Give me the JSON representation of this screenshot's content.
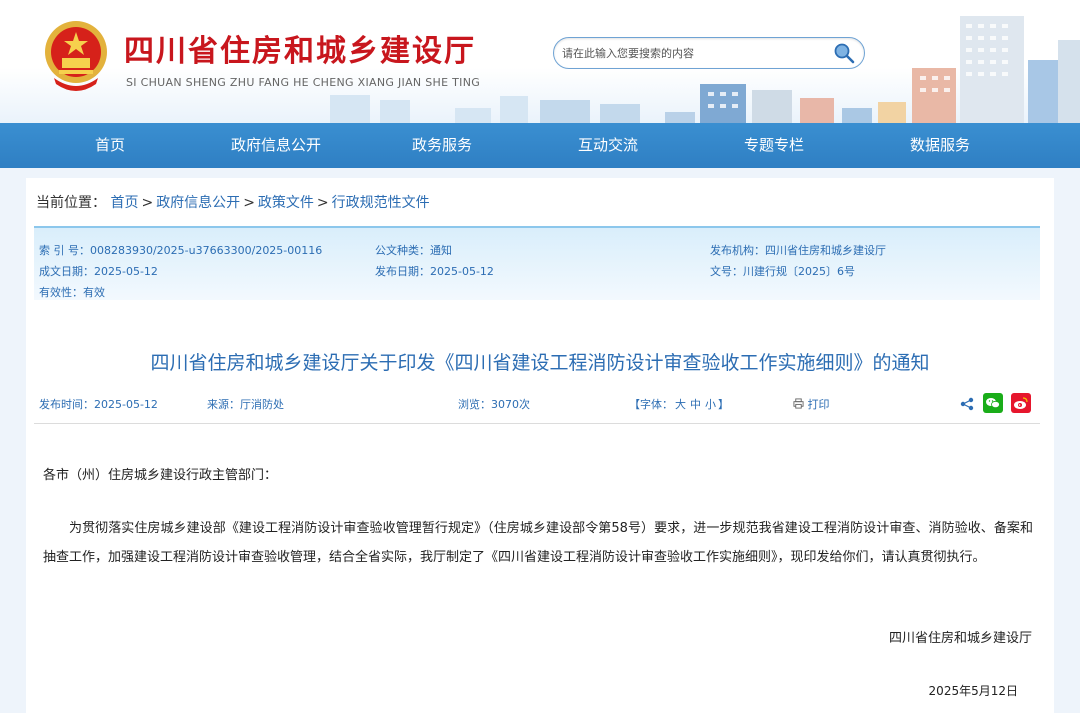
{
  "header": {
    "site_title": "四川省住房和城乡建设厅",
    "site_pinyin": "SI CHUAN SHENG ZHU FANG HE CHENG XIANG JIAN SHE TING",
    "search_placeholder": "请在此输入您要搜索的内容"
  },
  "nav": {
    "items": [
      {
        "label": "首页"
      },
      {
        "label": "政府信息公开"
      },
      {
        "label": "政务服务"
      },
      {
        "label": "互动交流"
      },
      {
        "label": "专题专栏"
      },
      {
        "label": "数据服务"
      }
    ]
  },
  "breadcrumb": {
    "prefix": "当前位置：",
    "items": [
      "首页",
      "政府信息公开",
      "政策文件",
      "行政规范性文件"
    ],
    "separator": ">"
  },
  "meta": {
    "index_no": "索 引 号：008283930/2025-u37663300/2025-00116",
    "category": "公文种类：通知",
    "publisher": "发布机构：四川省住房和城乡建设厅",
    "created": "成文日期：2025-05-12",
    "published": "发布日期：2025-05-12",
    "doc_no": "文号：川建行规〔2025〕6号",
    "validity": "有效性：有效"
  },
  "article": {
    "title": "四川省住房和城乡建设厅关于印发《四川省建设工程消防设计审查验收工作实施细则》的通知",
    "pub_time": "发布时间：2025-05-12",
    "source": "来源：厅消防处",
    "views": "浏览：3070次",
    "font_prefix": "【字体：",
    "font_large": "大",
    "font_medium": "中",
    "font_small": "小",
    "font_suffix": "】",
    "print": "打印",
    "salutation": "各市（州）住房城乡建设行政主管部门：",
    "paragraph": "为贯彻落实住房城乡建设部《建设工程消防设计审查验收管理暂行规定》（住房城乡建设部令第58号）要求，进一步规范我省建设工程消防设计审查、消防验收、备案和抽查工作，加强建设工程消防设计审查验收管理，结合全省实际，我厅制定了《四川省建设工程消防设计审查验收工作实施细则》，现印发给你们，请认真贯彻执行。",
    "signature": "四川省住房和城乡建设厅",
    "date": "2025年5月12日"
  },
  "colors": {
    "brand_red": "#c8161d",
    "nav_blue": "#3a8fd1",
    "link_blue": "#2c6db3"
  },
  "icons": [
    "national-emblem-icon",
    "search-icon",
    "print-icon",
    "share-icon",
    "wechat-icon",
    "weibo-icon"
  ]
}
